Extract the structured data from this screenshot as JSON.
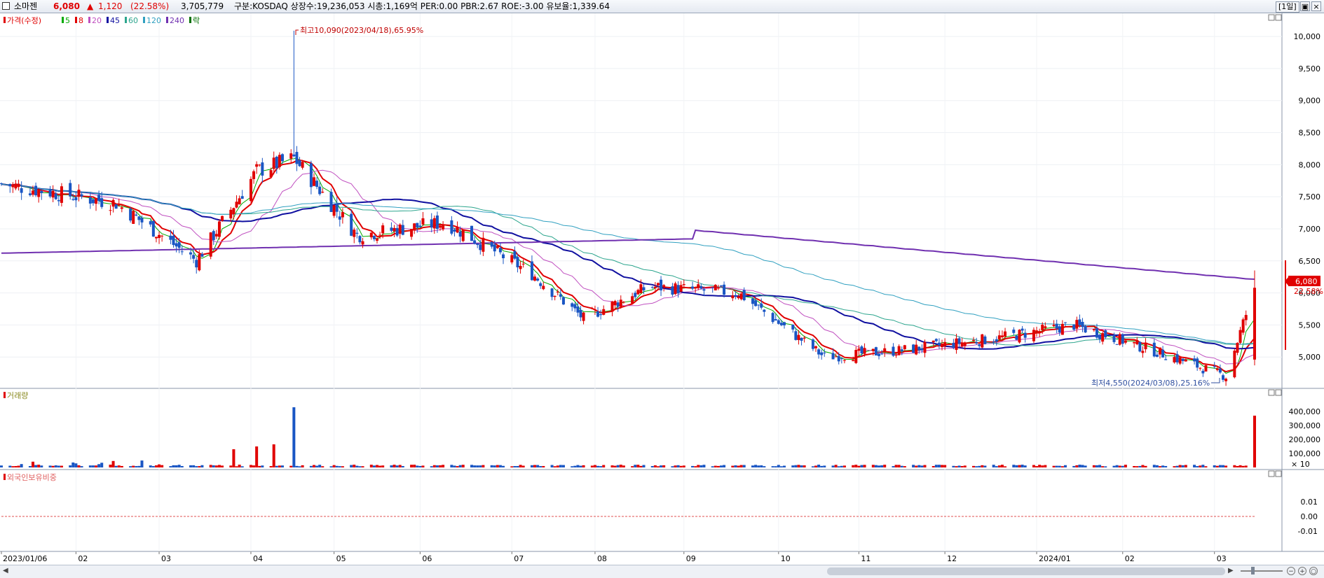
{
  "header": {
    "name": "소마젠",
    "price": "6,080",
    "change_arrow": "▲",
    "change": "1,120",
    "change_pct": "(22.58%)",
    "volume": "3,705,779",
    "info": "구분:KOSDAQ 상장수:19,236,053 시총:1,169억 PER:0.00 PBR:2.67 ROE:-3.00 유보율:1,339.64",
    "period": "[1일]",
    "btn_restore": "▣",
    "btn_close": "×"
  },
  "legend": {
    "price_label": "가격(수정)",
    "ma": [
      {
        "label": "5",
        "color": "#00aa00"
      },
      {
        "label": "8",
        "color": "#e00000"
      },
      {
        "label": "20",
        "color": "#c050c0"
      },
      {
        "label": "45",
        "color": "#1010a0"
      },
      {
        "label": "60",
        "color": "#2ca58d"
      },
      {
        "label": "120",
        "color": "#30a0c0"
      },
      {
        "label": "240",
        "color": "#7030b0"
      }
    ],
    "rak": "락"
  },
  "annotations": {
    "high": "최고10,090(2023/04/18),65.95%",
    "low": "최저4,550(2024/03/08),25.16%"
  },
  "last_price_tag": {
    "price": "6,080",
    "pct": "22.58%"
  },
  "panels": {
    "volume_label": "거래량",
    "volume_unit": "× 10",
    "foreign_label": "외국인보유비중"
  },
  "axes": {
    "price_ticks": [
      "10,000",
      "9,500",
      "9,000",
      "8,500",
      "8,000",
      "7,500",
      "7,000",
      "6,500",
      "6,000",
      "5,500",
      "5,000"
    ],
    "volume_ticks": [
      "400,000",
      "300,000",
      "200,000",
      "100,000"
    ],
    "foreign_ticks": [
      "0.01",
      "0.00",
      "-0.01"
    ],
    "x_ticks": [
      "2023/01/06",
      "02",
      "03",
      "04",
      "05",
      "06",
      "07",
      "08",
      "09",
      "10",
      "11",
      "12",
      "2024/01",
      "02",
      "03"
    ]
  },
  "colors": {
    "up": "#e00000",
    "down": "#1a56c4"
  },
  "chart_data": [
    {
      "type": "candlestick",
      "title": "소마젠",
      "ylim": [
        4500,
        10350
      ],
      "x_range": [
        "2023-01-06",
        "2024-03-18"
      ],
      "key_points": [
        {
          "date": "2023-01-06",
          "close": 7700
        },
        {
          "date": "2023-02-15",
          "close": 7400
        },
        {
          "date": "2023-03-15",
          "close": 6500
        },
        {
          "date": "2023-04-05",
          "close": 7900
        },
        {
          "date": "2023-04-18",
          "close": 8100,
          "high": 10090
        },
        {
          "date": "2023-05-10",
          "close": 6900
        },
        {
          "date": "2023-06-10",
          "close": 7100
        },
        {
          "date": "2023-07-10",
          "close": 6300
        },
        {
          "date": "2023-07-28",
          "close": 5600
        },
        {
          "date": "2023-08-20",
          "close": 6100
        },
        {
          "date": "2023-09-20",
          "close": 6000
        },
        {
          "date": "2023-10-20",
          "close": 5000
        },
        {
          "date": "2023-11-15",
          "close": 5100
        },
        {
          "date": "2023-12-20",
          "close": 5300
        },
        {
          "date": "2024-01-15",
          "close": 5500
        },
        {
          "date": "2024-02-15",
          "close": 5050
        },
        {
          "date": "2024-03-08",
          "close": 4700,
          "low": 4550
        },
        {
          "date": "2024-03-18",
          "close": 6080
        }
      ],
      "moving_averages": [
        {
          "name": "5",
          "color": "#00aa00"
        },
        {
          "name": "8",
          "color": "#e00000"
        },
        {
          "name": "20",
          "color": "#c050c0"
        },
        {
          "name": "45",
          "color": "#1010a0"
        },
        {
          "name": "60",
          "color": "#2ca58d"
        },
        {
          "name": "120",
          "color": "#30a0c0"
        },
        {
          "name": "240",
          "color": "#7030b0"
        }
      ]
    },
    {
      "type": "bar",
      "title": "거래량",
      "ylim": [
        0,
        450000
      ],
      "spikes": [
        {
          "date": "2023-04-18",
          "value": 430000
        },
        {
          "date": "2023-03-28",
          "value": 130000
        },
        {
          "date": "2023-04-05",
          "value": 150000
        },
        {
          "date": "2023-04-11",
          "value": 165000
        },
        {
          "date": "2024-03-18",
          "value": 370000
        }
      ]
    },
    {
      "type": "line",
      "title": "외국인보유비중",
      "ylim": [
        -0.01,
        0.01
      ],
      "values": [
        0.0
      ]
    }
  ]
}
